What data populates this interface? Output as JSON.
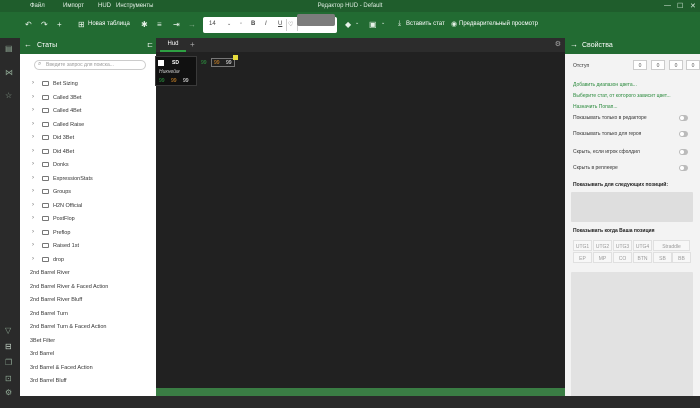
{
  "titlebar": {
    "menu": [
      "Файл",
      "Импорт",
      "HUD",
      "Инструменты"
    ],
    "title": "Редактор HUD - Default",
    "controls": [
      "—",
      "☐",
      "✕"
    ]
  },
  "toolbar": {
    "new_table": "Новая таблица",
    "font_size": "14",
    "bold": "B",
    "italic": "I",
    "underline": "U",
    "insert_stat": "Вставить стат",
    "preview": "Предварительный просмотр"
  },
  "stats_panel": {
    "title": "Статы",
    "search_placeholder": "Введите запрос для поиска...",
    "folders": [
      "Bet Sizing",
      "Called 3Bet",
      "Called 4Bet",
      "Called Raise",
      "Did 3Bet",
      "Did 4Bet",
      "Donks",
      "ExpressionStats",
      "Groups",
      "H2N Official",
      "PostFlop",
      "Preflop",
      "Raised 1st",
      "drop"
    ],
    "items": [
      "2nd Barrel River",
      "2nd Barrel River & Faced Action",
      "2nd Barrel River Bluff",
      "2nd Barrel Turn",
      "2nd Barrel Turn & Faced Action",
      "3Bet Filter",
      "3rd Barrel",
      "3rd Barrel & Faced Action",
      "3rd Barrel Bluff"
    ]
  },
  "hud": {
    "tab": "Hud",
    "name": "SD",
    "nickname": "Никнейм",
    "values": [
      "99",
      "99",
      "99"
    ],
    "stat_values": [
      "99",
      "99",
      "99"
    ],
    "colors": {
      "green": "#2ea043",
      "orange": "#e0902a",
      "white": "#ffffff",
      "yellow": "#e6dc3c"
    }
  },
  "properties": {
    "title": "Свойства",
    "padding_label": "Отступ",
    "padding_values": [
      "0",
      "0",
      "0",
      "0"
    ],
    "links": [
      "Добавить диапазон цвета...",
      "Выберите стат, от которого зависит цвет...",
      "Назначить Попап..."
    ],
    "toggles": [
      "Показывать только в редакторе",
      "Показывать только для героя",
      "Скрыть, если игрок сфолдил",
      "Скрыть в реплеере"
    ],
    "positions_title": "Показывать для следующих позиций:",
    "hero_positions_title": "Показывать когда Ваша позиция",
    "positions": [
      "UTG1",
      "UTG2",
      "UTG3",
      "UTG4",
      "Straddle",
      "EP",
      "MP",
      "CO",
      "BTN",
      "SB",
      "BB"
    ]
  }
}
